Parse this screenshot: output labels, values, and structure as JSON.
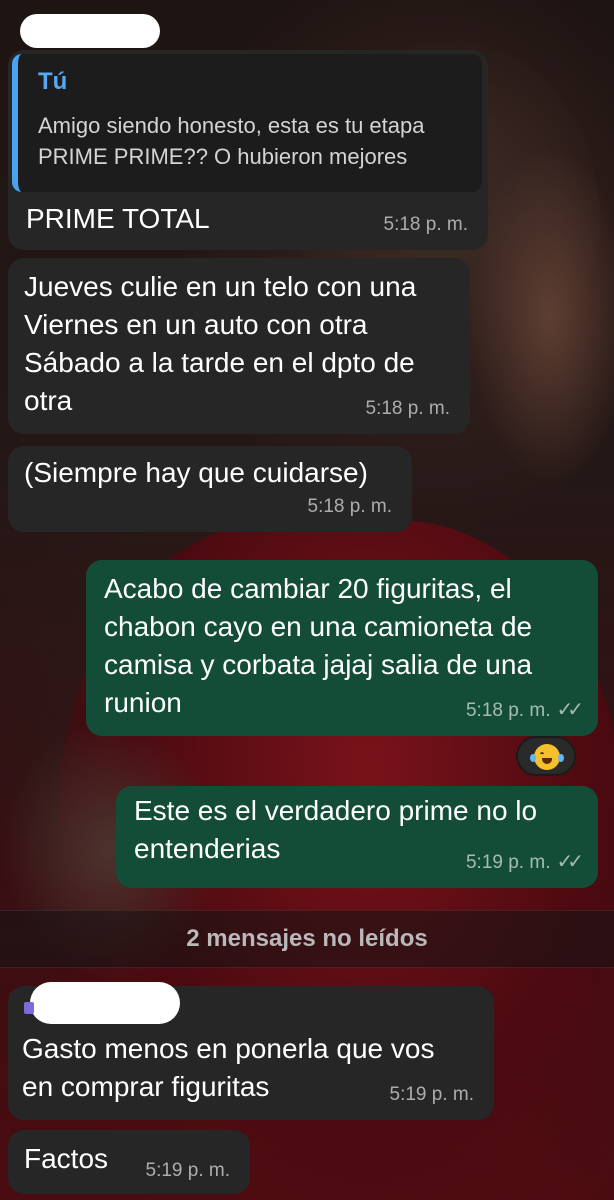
{
  "colors": {
    "incoming_bubble": "#262626",
    "outgoing_bubble": "#134d37",
    "quote_accent": "#4aa3f0",
    "quote_author": "#57a8f2"
  },
  "messages": [
    {
      "direction": "incoming",
      "quote": {
        "author": "Tú",
        "text": "Amigo siendo honesto, esta es tu etapa\nPRIME PRIME?? O hubieron mejores"
      },
      "text": "PRIME TOTAL",
      "time": "5:18 p. m."
    },
    {
      "direction": "incoming",
      "text": "Jueves culie en un telo con una\nViernes en un auto con otra\nSábado a la tarde en el dpto de\notra",
      "time": "5:18 p. m."
    },
    {
      "direction": "incoming",
      "text": "(Siempre hay que cuidarse)",
      "time": "5:18 p. m."
    },
    {
      "direction": "outgoing",
      "text": "Acabo de cambiar 20 figuritas, el\nchabon cayo en una camioneta de\ncamisa y corbata jajaj salia de una\nrunion",
      "time": "5:18 p. m.",
      "status_icon": "double-check-icon",
      "reaction": "face-with-tears-of-joy-emoji"
    },
    {
      "direction": "outgoing",
      "text": "Este es el verdadero prime no lo\nentenderias",
      "time": "5:19 p. m.",
      "status_icon": "double-check-icon"
    },
    {
      "direction": "incoming",
      "text": "Gasto menos en ponerla que vos\nen comprar figuritas",
      "time": "5:19 p. m."
    },
    {
      "direction": "incoming",
      "text": "Factos",
      "time": "5:19 p. m."
    }
  ],
  "unread_divider": "2 mensajes no leídos"
}
